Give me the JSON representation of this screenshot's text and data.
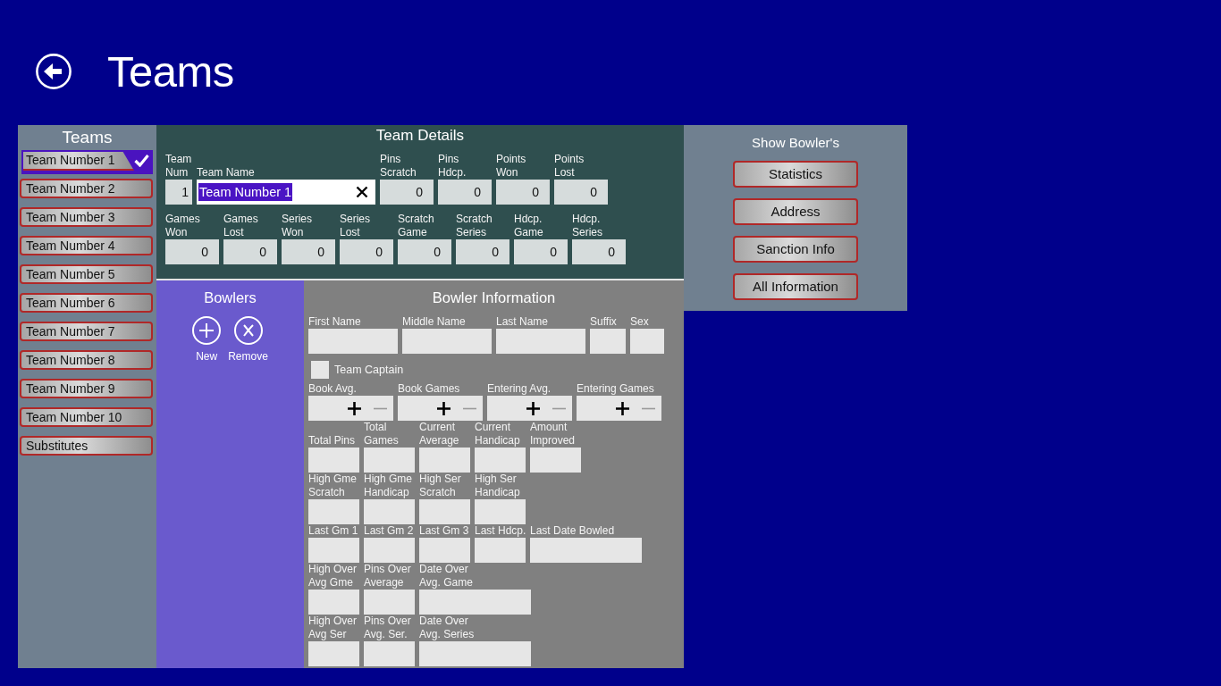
{
  "header": {
    "title": "Teams"
  },
  "teams_panel": {
    "title": "Teams",
    "items": [
      {
        "label": "Team Number 1",
        "selected": true
      },
      {
        "label": "Team Number 2",
        "selected": false
      },
      {
        "label": "Team Number 3",
        "selected": false
      },
      {
        "label": "Team Number 4",
        "selected": false
      },
      {
        "label": "Team Number 5",
        "selected": false
      },
      {
        "label": "Team Number 6",
        "selected": false
      },
      {
        "label": "Team Number 7",
        "selected": false
      },
      {
        "label": "Team Number 8",
        "selected": false
      },
      {
        "label": "Team Number 9",
        "selected": false
      },
      {
        "label": "Team Number 10",
        "selected": false
      },
      {
        "label": "Substitutes",
        "selected": false
      }
    ]
  },
  "team_details": {
    "title": "Team Details",
    "rows": [
      {
        "fields": [
          {
            "label": "Team\nNum",
            "value": "1",
            "kind": "number"
          },
          {
            "label": "Team Name",
            "value": "Team Number 1",
            "kind": "text",
            "text_selected": true
          },
          {
            "label": "Pins\nScratch",
            "value": "0",
            "kind": "number"
          },
          {
            "label": "Pins\nHdcp.",
            "value": "0",
            "kind": "number"
          },
          {
            "label": "Points\nWon",
            "value": "0",
            "kind": "number"
          },
          {
            "label": "Points\nLost",
            "value": "0",
            "kind": "number"
          }
        ]
      },
      {
        "fields": [
          {
            "label": "Games\nWon",
            "value": "0",
            "kind": "number"
          },
          {
            "label": "Games\nLost",
            "value": "0",
            "kind": "number"
          },
          {
            "label": "Series\nWon",
            "value": "0",
            "kind": "number"
          },
          {
            "label": "Series\nLost",
            "value": "0",
            "kind": "number"
          },
          {
            "label": "Scratch\nGame",
            "value": "0",
            "kind": "number"
          },
          {
            "label": "Scratch\nSeries",
            "value": "0",
            "kind": "number"
          },
          {
            "label": "Hdcp.\nGame",
            "value": "0",
            "kind": "number"
          },
          {
            "label": "Hdcp.\nSeries",
            "value": "0",
            "kind": "number"
          }
        ]
      }
    ]
  },
  "bowlers_panel": {
    "title": "Bowlers",
    "actions": [
      {
        "label": "New",
        "kind": "add"
      },
      {
        "label": "Remove",
        "kind": "remove"
      }
    ]
  },
  "bowler_information": {
    "title": "Bowler Information",
    "name_fields": [
      {
        "label": "First Name"
      },
      {
        "label": "Middle Name"
      },
      {
        "label": "Last Name"
      },
      {
        "label": "Suffix"
      },
      {
        "label": "Sex"
      }
    ],
    "team_captain": {
      "label": "Team Captain",
      "checked": false
    },
    "spinners": [
      {
        "label": "Book Avg.",
        "increment_disabled": false,
        "decrement_disabled": true
      },
      {
        "label": "Book Games",
        "increment_disabled": false,
        "decrement_disabled": true
      },
      {
        "label": "Entering Avg.",
        "increment_disabled": false,
        "decrement_disabled": true
      },
      {
        "label": "Entering Games",
        "increment_disabled": false,
        "decrement_disabled": true
      }
    ],
    "stat_rows": [
      {
        "fields": [
          {
            "label": "Total Pins",
            "kind": "number"
          },
          {
            "label": "Total\nGames",
            "kind": "number"
          },
          {
            "label": "Current\nAverage",
            "kind": "number"
          },
          {
            "label": "Current\nHandicap",
            "kind": "number"
          },
          {
            "label": "Amount\nImproved",
            "kind": "number"
          }
        ]
      },
      {
        "fields": [
          {
            "label": "High Gme\nScratch",
            "kind": "number"
          },
          {
            "label": "High Gme\nHandicap",
            "kind": "number"
          },
          {
            "label": "High Ser\nScratch",
            "kind": "number"
          },
          {
            "label": "High Ser\nHandicap",
            "kind": "number"
          }
        ]
      },
      {
        "fields": [
          {
            "label": "Last Gm 1",
            "kind": "number"
          },
          {
            "label": "Last Gm 2",
            "kind": "number"
          },
          {
            "label": "Last Gm 3",
            "kind": "number"
          },
          {
            "label": "Last Hdcp.",
            "kind": "number"
          },
          {
            "label": "Last Date Bowled",
            "kind": "date"
          }
        ]
      },
      {
        "fields": [
          {
            "label": "High Over\nAvg Gme",
            "kind": "number"
          },
          {
            "label": "Pins Over\nAverage",
            "kind": "number"
          },
          {
            "label": "Date Over\nAvg. Game",
            "kind": "date"
          }
        ]
      },
      {
        "fields": [
          {
            "label": "High Over\nAvg Ser",
            "kind": "number"
          },
          {
            "label": "Pins Over\nAvg. Ser.",
            "kind": "number"
          },
          {
            "label": "Date Over\nAvg. Series",
            "kind": "date"
          }
        ]
      }
    ]
  },
  "show_bowlers_panel": {
    "title": "Show Bowler's",
    "buttons": [
      "Statistics",
      "Address",
      "Sanction Info",
      "All Information"
    ]
  }
}
